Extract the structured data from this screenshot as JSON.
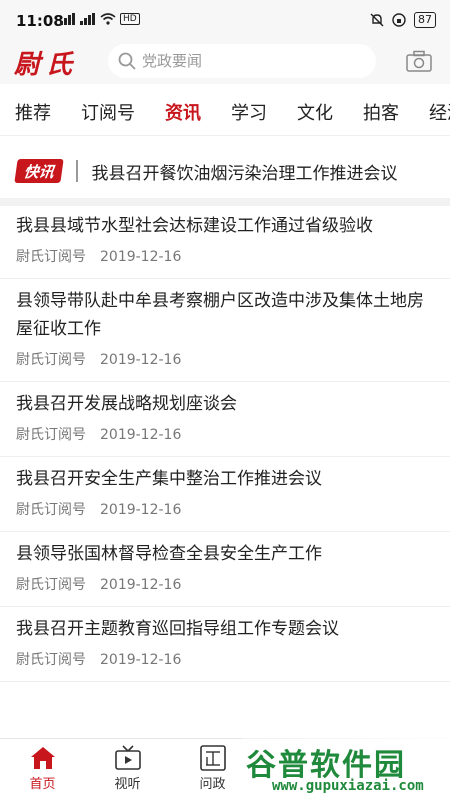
{
  "status": {
    "time": "11:08",
    "network_1": "5G",
    "network_2": "5G",
    "hd": "HD",
    "battery": "87"
  },
  "header": {
    "logo": "尉氏",
    "search_placeholder": "党政要闻"
  },
  "tabs": [
    {
      "label": "推荐"
    },
    {
      "label": "订阅号"
    },
    {
      "label": "资讯"
    },
    {
      "label": "学习"
    },
    {
      "label": "文化"
    },
    {
      "label": "拍客"
    },
    {
      "label": "经济"
    }
  ],
  "flash": {
    "badge": "快讯",
    "text": "我县召开餐饮油烟污染治理工作推进会议"
  },
  "news": [
    {
      "title": "我县县域节水型社会达标建设工作通过省级验收",
      "source": "尉氏订阅号",
      "date": "2019-12-16"
    },
    {
      "title": "县领导带队赴中牟县考察棚户区改造中涉及集体土地房屋征收工作",
      "source": "尉氏订阅号",
      "date": "2019-12-16"
    },
    {
      "title": "我县召开发展战略规划座谈会",
      "source": "尉氏订阅号",
      "date": "2019-12-16"
    },
    {
      "title": "我县召开安全生产集中整治工作推进会议",
      "source": "尉氏订阅号",
      "date": "2019-12-16"
    },
    {
      "title": "县领导张国林督导检查全县安全生产工作",
      "source": "尉氏订阅号",
      "date": "2019-12-16"
    },
    {
      "title": "我县召开主题教育巡回指导组工作专题会议",
      "source": "尉氏订阅号",
      "date": "2019-12-16"
    }
  ],
  "bottom_nav": [
    {
      "label": "首页",
      "icon": "home-icon"
    },
    {
      "label": "视听",
      "icon": "tv-icon"
    },
    {
      "label": "问政",
      "icon": "zheng-icon"
    }
  ],
  "watermark": {
    "logo": "谷普软件园",
    "url": "www.gupuxiazai.com"
  },
  "colors": {
    "accent": "#c8161d",
    "watermark": "#1f8a3b"
  }
}
